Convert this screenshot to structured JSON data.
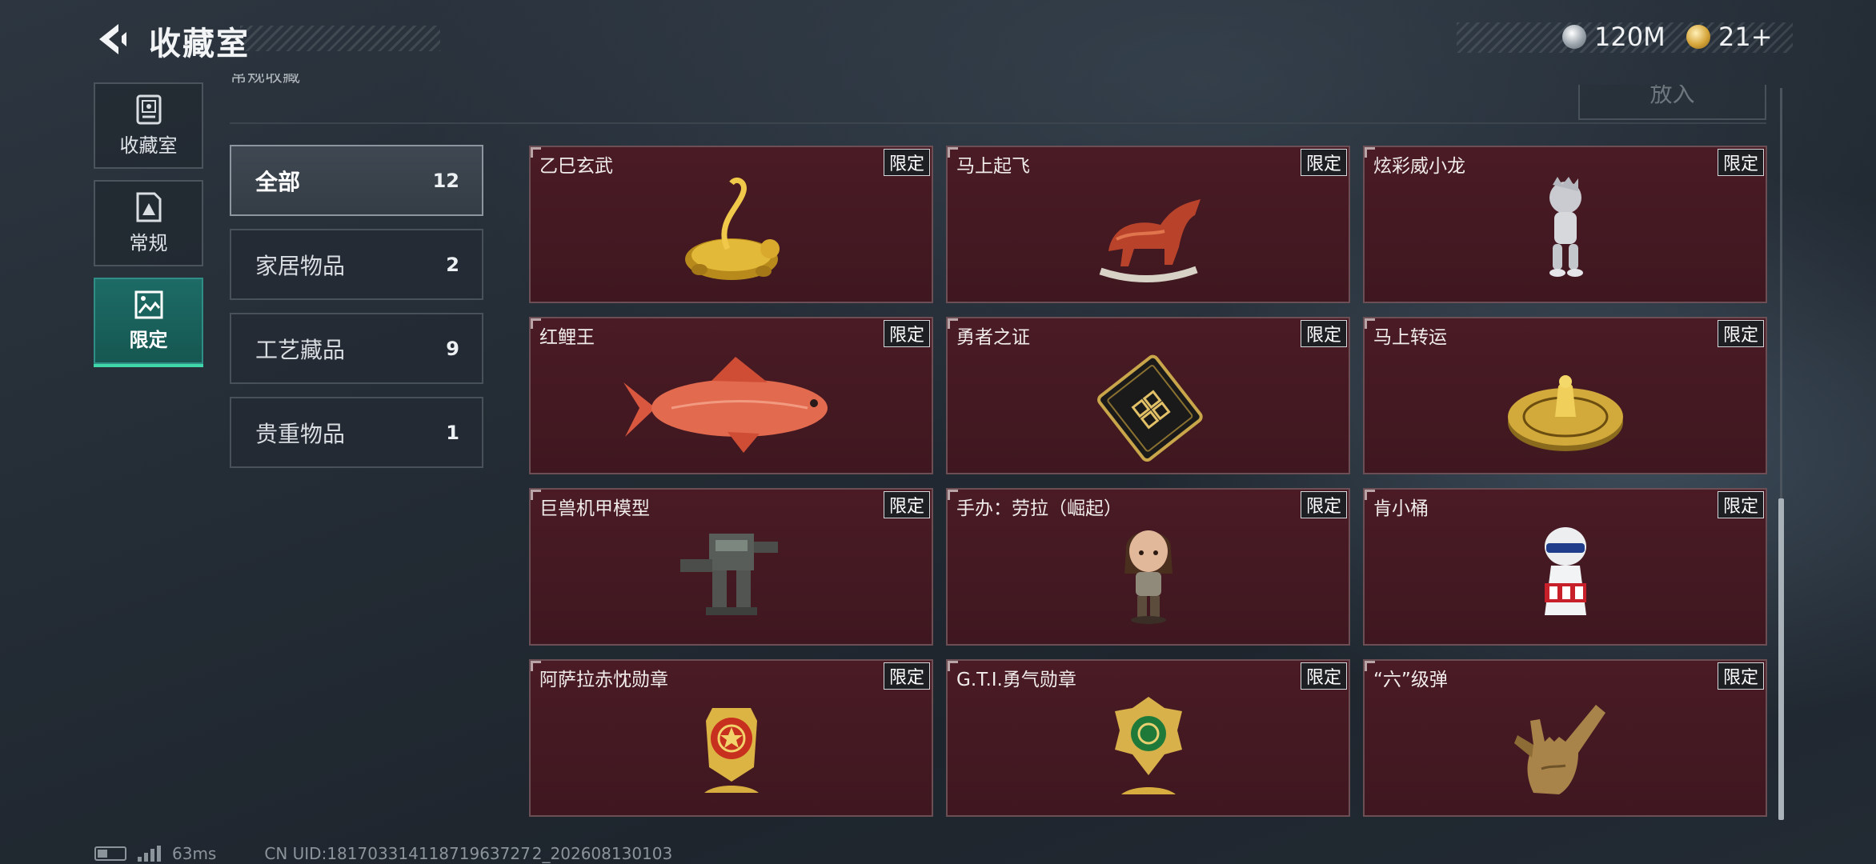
{
  "header": {
    "title": "收藏室",
    "currencies": [
      {
        "icon": "silver-coin-icon",
        "amount": "120M"
      },
      {
        "icon": "gold-coin-icon",
        "amount": "21+"
      }
    ]
  },
  "nav": {
    "items": [
      {
        "label": "收藏室",
        "icon": "bin-icon",
        "active": false
      },
      {
        "label": "常规",
        "icon": "document-icon",
        "active": false
      },
      {
        "label": "限定",
        "icon": "gallery-icon",
        "active": true
      }
    ]
  },
  "toolbar": {
    "cut_text": "常规收藏",
    "place_label": "放入"
  },
  "categories": [
    {
      "label": "全部",
      "count": "12",
      "active": true
    },
    {
      "label": "家居物品",
      "count": "2",
      "active": false
    },
    {
      "label": "工艺藏品",
      "count": "9",
      "active": false
    },
    {
      "label": "贵重物品",
      "count": "1",
      "active": false
    }
  ],
  "items": [
    {
      "name": "乙巳玄武",
      "badge": "限定",
      "icon": "golden-turtle-snake-icon"
    },
    {
      "name": "马上起飞",
      "badge": "限定",
      "icon": "horse-icon"
    },
    {
      "name": "炫彩威小龙",
      "badge": "限定",
      "icon": "dragon-figure-icon"
    },
    {
      "name": "红鲤王",
      "badge": "限定",
      "icon": "carp-icon"
    },
    {
      "name": "勇者之证",
      "badge": "限定",
      "icon": "card-icon"
    },
    {
      "name": "马上转运",
      "badge": "限定",
      "icon": "fortune-wheel-icon"
    },
    {
      "name": "巨兽机甲模型",
      "badge": "限定",
      "icon": "mech-model-icon"
    },
    {
      "name": "手办：劳拉（崛起）",
      "badge": "限定",
      "icon": "figurine-icon"
    },
    {
      "name": "肯小桶",
      "badge": "限定",
      "icon": "colonel-figure-icon"
    },
    {
      "name": "阿萨拉赤忱勋章",
      "badge": "限定",
      "icon": "red-medal-icon"
    },
    {
      "name": "G.T.I.勇气勋章",
      "badge": "限定",
      "icon": "green-medal-icon"
    },
    {
      "name": "“六”级弹",
      "badge": "限定",
      "icon": "golden-hand-icon"
    }
  ],
  "footer": {
    "ping": "63ms",
    "uid": "CN UID:18170331411871963727 2_202608130103"
  }
}
